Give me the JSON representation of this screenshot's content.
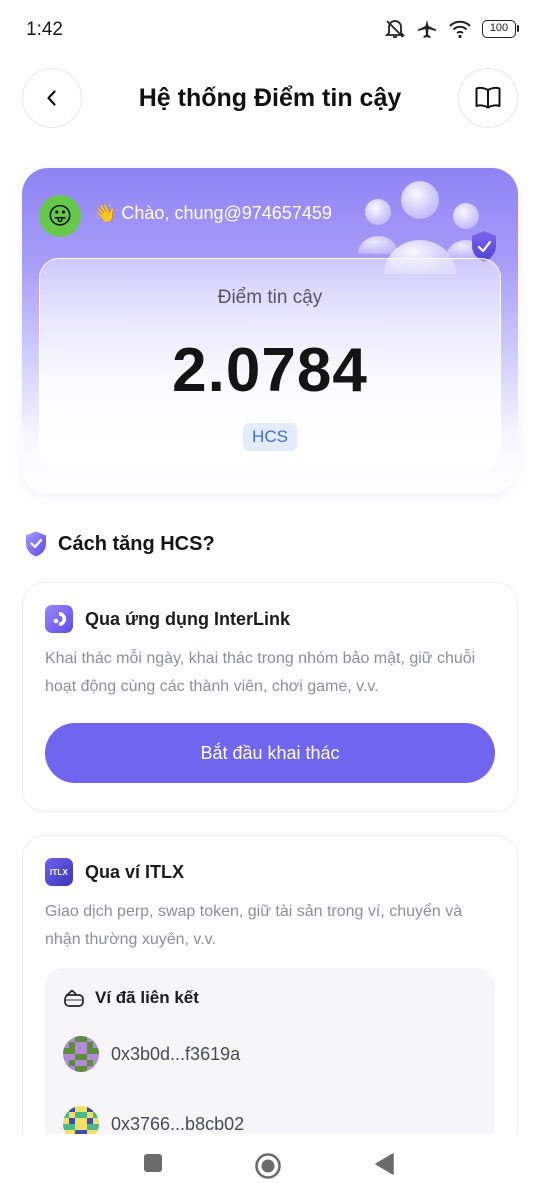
{
  "status_bar": {
    "time": "1:42",
    "battery": "100",
    "icons": [
      "mute-icon",
      "airplane-icon",
      "wifi-icon",
      "battery-icon"
    ]
  },
  "header": {
    "title": "Hệ thống Điểm tin cậy",
    "back_icon": "chevron-left-icon",
    "guide_icon": "book-icon"
  },
  "hero": {
    "avatar_emoji": "😛",
    "greeting": "👋 Chào, chung@974657459",
    "score_label": "Điểm tin cậy",
    "score_value": "2.0784",
    "score_unit": "HCS"
  },
  "section": {
    "title": "Cách tăng HCS?"
  },
  "method_app": {
    "title": "Qua ứng dụng InterLink",
    "description": "Khai thác mỗi ngày, khai thác trong nhóm bảo mật, giữ chuỗi hoạt động cùng các thành viên, chơi game, v.v.",
    "button_label": "Bắt đầu khai thác"
  },
  "method_wallet": {
    "logo_text": "ITLX",
    "title": "Qua ví ITLX",
    "description": "Giao dịch perp, swap token, giữ tài sản trong ví, chuyển và nhận thường xuyên, v.v.",
    "linked_title": "Ví đã liên kết",
    "wallets": [
      {
        "address": "0x3b0d...f3619a"
      },
      {
        "address": "0x3766...b8cb02"
      }
    ]
  },
  "colors": {
    "accent": "#7065ee",
    "hero_top": "#8f83f5",
    "unit_badge_bg": "#e3ecfb",
    "unit_badge_text": "#3d6fd6"
  }
}
